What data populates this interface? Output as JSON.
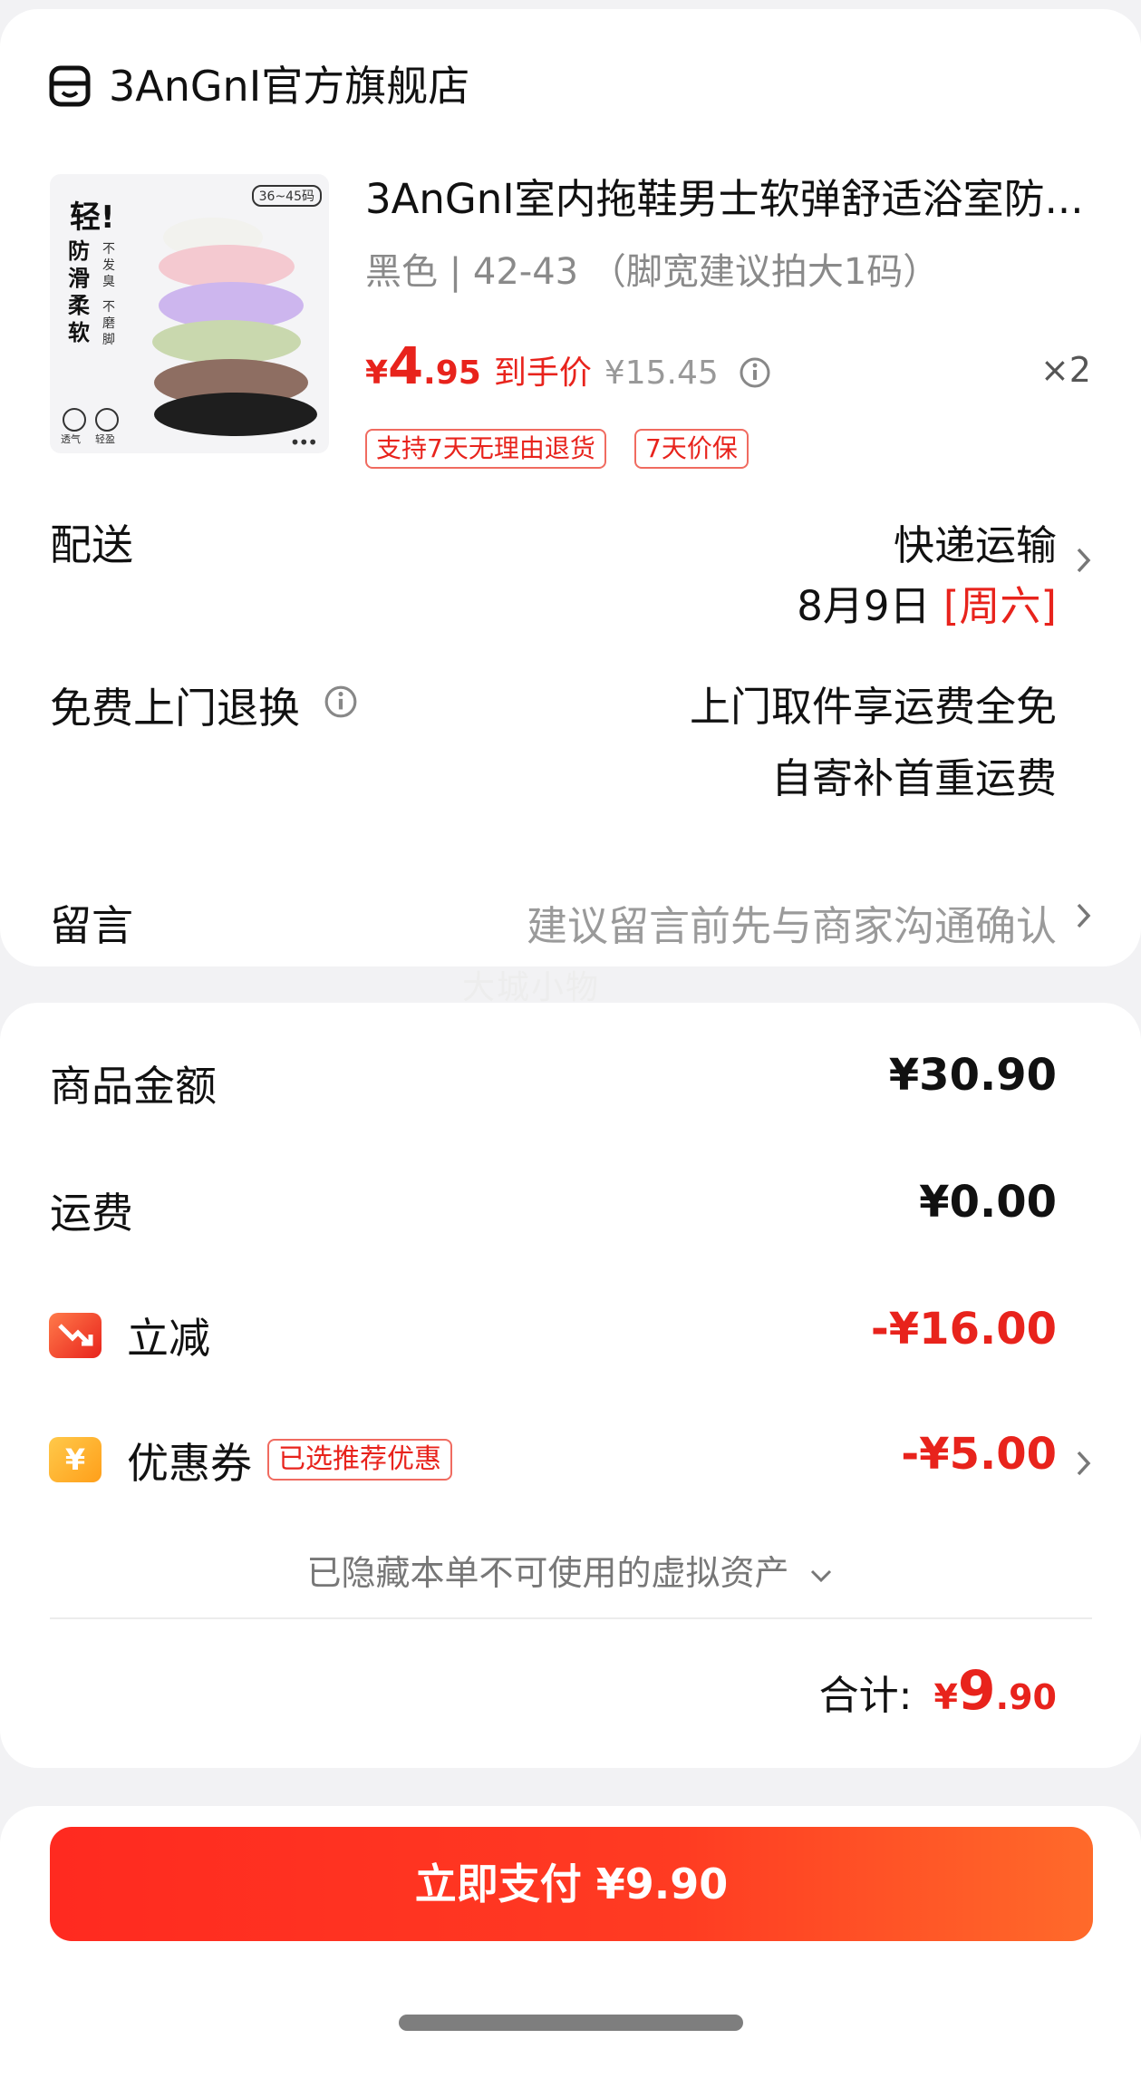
{
  "store": {
    "name": "3AnGnI官方旗舰店",
    "icon": "store-icon"
  },
  "product": {
    "title": "3AnGnI室内拖鞋男士软弹舒适浴室防...",
    "spec": "黑色 | 42-43 （脚宽建议拍大1码）",
    "price": {
      "currency": "¥",
      "integer": "4",
      "decimal": ".95",
      "tag": "到手价",
      "original": "¥15.45"
    },
    "quantity": "×2",
    "tags": [
      "支持7天无理由退货",
      "7天价保"
    ],
    "image_text": {
      "headline": "轻!",
      "vertical_1": "防滑柔软",
      "vertical_2": "不发臭",
      "vertical_3": "不磨脚",
      "size_badge": "36~45码",
      "icon_1": "透气",
      "icon_2": "轻盈"
    }
  },
  "delivery": {
    "label": "配送",
    "method": "快递运输",
    "date": "8月9日",
    "weekday": "[周六]"
  },
  "return_service": {
    "label": "免费上门退换",
    "line1": "上门取件享运费全免",
    "line2": "自寄补首重运费"
  },
  "message": {
    "label": "留言",
    "placeholder": "建议留言前先与商家沟通确认"
  },
  "watermark": "大城小物",
  "summary": {
    "goods_label": "商品金额",
    "goods_value": "¥30.90",
    "shipping_label": "运费",
    "shipping_value": "¥0.00",
    "discount_label": "立减",
    "discount_value": "-¥16.00",
    "coupon_label": "优惠券",
    "coupon_badge": "已选推荐优惠",
    "coupon_value": "-¥5.00",
    "coupon_icon_glyph": "¥",
    "hidden_assets": "已隐藏本单不可使用的虚拟资产",
    "total_label": "合计:",
    "total": {
      "currency": "¥",
      "integer": "9",
      "decimal": ".90"
    }
  },
  "pay_button": {
    "label": "立即支付 ¥9.90"
  },
  "colors": {
    "accent_red": "#e8231c",
    "coupon_orange": "#ff9f1a"
  }
}
